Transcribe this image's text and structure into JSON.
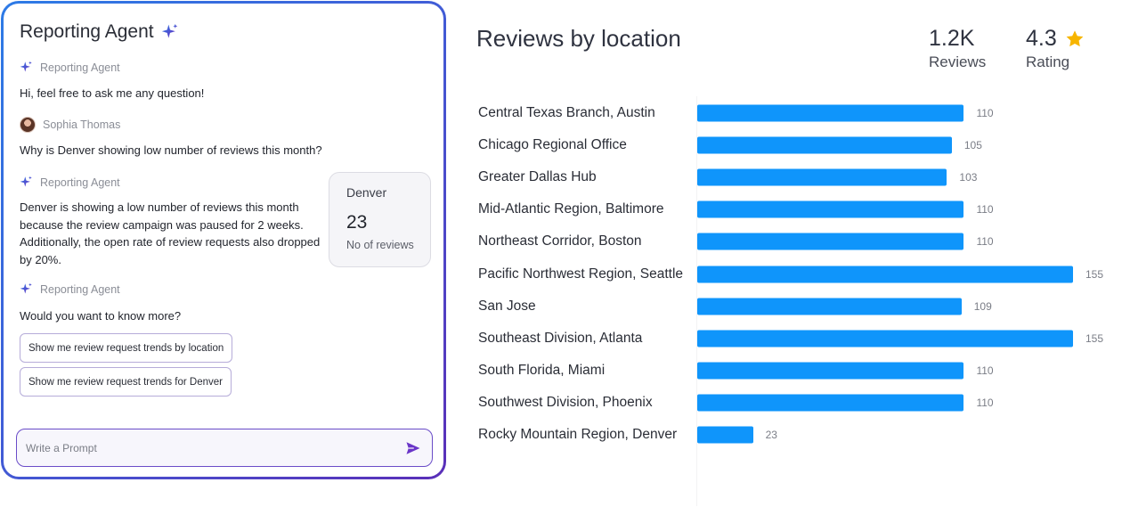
{
  "chat": {
    "title": "Reporting Agent",
    "messages": [
      {
        "sender": "Reporting Agent",
        "text": "Hi, feel free to ask me any question!"
      },
      {
        "sender": "Sophia Thomas",
        "text": "Why is Denver showing low number of reviews this month?"
      },
      {
        "sender": "Reporting Agent",
        "text": "Denver is showing a low number of reviews this month because the review campaign was paused for 2 weeks. Additionally, the open rate of review requests also dropped by 20%."
      },
      {
        "sender": "Reporting Agent",
        "text": "Would you want to know more?"
      }
    ],
    "stat_card": {
      "city": "Denver",
      "value": "23",
      "label": "No of reviews"
    },
    "suggestions": [
      "Show me review request trends by location",
      "Show me review request trends for Denver"
    ],
    "prompt": {
      "placeholder": "Write a Prompt",
      "value": ""
    }
  },
  "header": {
    "title": "Reviews by location",
    "reviews_value": "1.2K",
    "reviews_label": "Reviews",
    "rating_value": "4.3",
    "rating_label": "Rating"
  },
  "colors": {
    "bar": "#0f95fb",
    "accent": "#5a2fb8",
    "star": "#f7b500"
  },
  "chart_data": {
    "type": "bar",
    "orientation": "horizontal",
    "title": "Reviews by location",
    "categories": [
      "Central Texas Branch, Austin",
      "Chicago Regional Office",
      "Greater Dallas Hub",
      "Mid-Atlantic Region, Baltimore",
      "Northeast Corridor, Boston",
      "Pacific Northwest Region, Seattle",
      "San Jose",
      "Southeast Division, Atlanta",
      "South Florida, Miami",
      "Southwest Division, Phoenix",
      "Rocky Mountain Region, Denver"
    ],
    "values": [
      110,
      105,
      103,
      110,
      110,
      155,
      109,
      155,
      110,
      110,
      23
    ],
    "xlim": [
      0,
      155
    ],
    "grid": false,
    "legend": "none"
  }
}
